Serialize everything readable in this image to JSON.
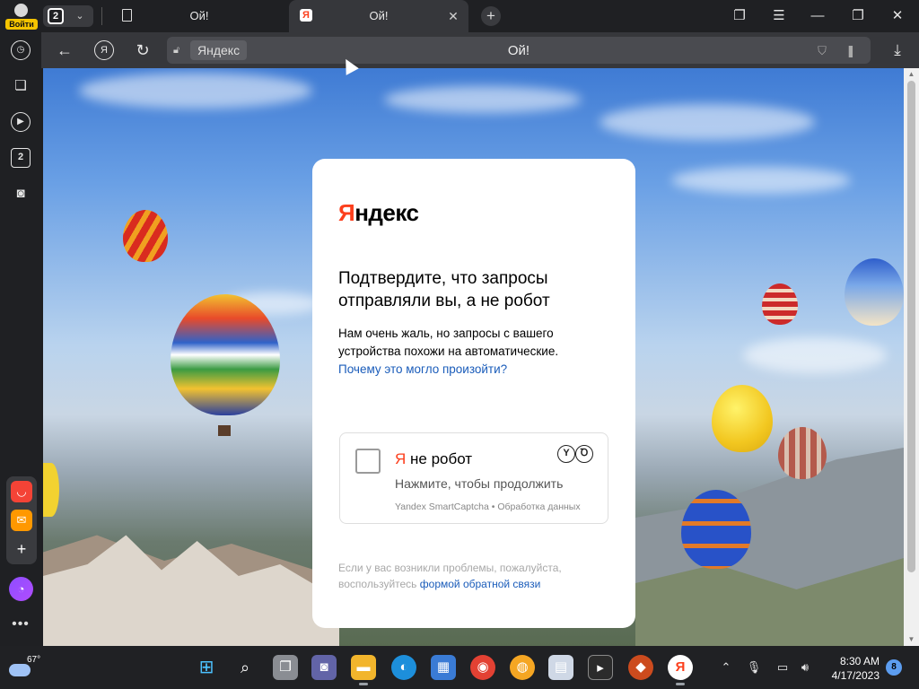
{
  "profile": {
    "login_label": "Войти"
  },
  "tabs": {
    "count": "2",
    "items": [
      {
        "title": "Ой!"
      },
      {
        "title": "Ой!"
      }
    ]
  },
  "favicon": {
    "letter": "Я"
  },
  "toolbar": {
    "yandex_button_label": "Я",
    "domain_chip": "Яндекс",
    "address_title": "Ой!"
  },
  "sidebar": {
    "tab_badge": "2",
    "apps": [
      {
        "name": "market",
        "color": "#f44336"
      },
      {
        "name": "mail",
        "color": "#ff9800"
      }
    ]
  },
  "card": {
    "logo_first": "Я",
    "logo_rest": "ндекс",
    "headline": "Подтвердите, что запросы отправляли вы, а не робот",
    "description": "Нам очень жаль, но запросы с вашего устройства похожи на автоматические.",
    "why_link": "Почему это могло произойти?",
    "captcha": {
      "title_first": "Я",
      "title_rest": " не робот",
      "hint": "Нажмите, чтобы продолжить",
      "footer": "Yandex SmartCaptcha • Обработка данных",
      "logo_left": "Y",
      "logo_right": "Ꝺ"
    },
    "help_text": "Если у вас возникли проблемы, пожалуйста, воспользуйтесь",
    "help_link": "формой обратной связи"
  },
  "taskbar": {
    "temperature": "67°",
    "time": "8:30 AM",
    "date": "4/17/2023",
    "notifications": "8"
  },
  "colors": {
    "yandex_red": "#fc3f1d",
    "link_blue": "#1a5cba",
    "chrome_dark": "#1f2023",
    "toolbar": "#36373b"
  }
}
